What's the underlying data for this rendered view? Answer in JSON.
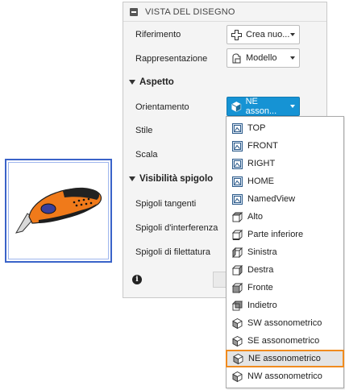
{
  "panel": {
    "title": "VISTA DEL DISEGNO",
    "rows": {
      "riferimento": {
        "label": "Riferimento",
        "value": "Crea nuo...",
        "icon": "plus-icon"
      },
      "rappresentazione": {
        "label": "Rappresentazione",
        "value": "Modello",
        "icon": "model-icon"
      }
    },
    "aspetto": {
      "section_label": "Aspetto",
      "orientamento": {
        "label": "Orientamento",
        "value": "NE asson...",
        "icon": "iso-cube-icon"
      },
      "stile_label": "Stile",
      "scala_label": "Scala"
    },
    "visibilita": {
      "section_label": "Visibilità spigolo",
      "tangenti_label": "Spigoli tangenti",
      "interferenza_label": "Spigoli d'interferenza",
      "filettatura_label": "Spigoli di filettatura"
    },
    "info_icon": "i"
  },
  "dropdown": {
    "items": [
      {
        "label": "TOP",
        "icon": "named-view-icon"
      },
      {
        "label": "FRONT",
        "icon": "named-view-icon"
      },
      {
        "label": "RIGHT",
        "icon": "named-view-icon"
      },
      {
        "label": "HOME",
        "icon": "named-view-icon"
      },
      {
        "label": "NamedView",
        "icon": "named-view-icon"
      },
      {
        "label": "Alto",
        "icon": "cube-top-icon"
      },
      {
        "label": "Parte inferiore",
        "icon": "cube-bottom-icon"
      },
      {
        "label": "Sinistra",
        "icon": "cube-left-icon"
      },
      {
        "label": "Destra",
        "icon": "cube-right-icon"
      },
      {
        "label": "Fronte",
        "icon": "cube-front-icon"
      },
      {
        "label": "Indietro",
        "icon": "cube-back-icon"
      },
      {
        "label": "SW assonometrico",
        "icon": "iso-cube-icon"
      },
      {
        "label": "SE assonometrico",
        "icon": "iso-cube-icon"
      },
      {
        "label": "NE assonometrico",
        "icon": "iso-cube-icon",
        "selected": true
      },
      {
        "label": "NW assonometrico",
        "icon": "iso-cube-icon"
      }
    ]
  },
  "colors": {
    "accent": "#1693d4",
    "highlight": "#f08b1e"
  }
}
